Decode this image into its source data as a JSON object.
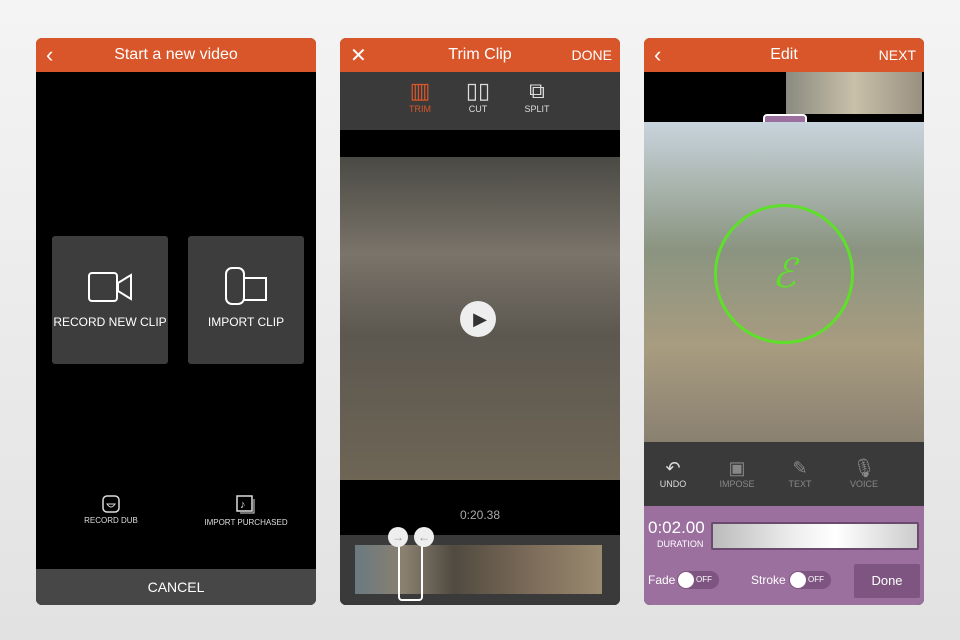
{
  "screen1": {
    "title": "Start a new video",
    "record_new_clip": "RECORD NEW CLIP",
    "import_clip": "IMPORT CLIP",
    "record_dub": "RECORD DUB",
    "import_purchased": "IMPORT PURCHASED",
    "cancel": "CANCEL"
  },
  "screen2": {
    "title": "Trim Clip",
    "done": "DONE",
    "tools": [
      "TRIM",
      "CUT",
      "SPLIT"
    ],
    "active_tool": "TRIM",
    "timestamp": "0:20.38"
  },
  "screen3": {
    "title": "Edit",
    "next": "NEXT",
    "tools": [
      "UNDO",
      "IMPOSE",
      "TEXT",
      "VOICE"
    ],
    "duration_value": "0:02.00",
    "duration_label": "DURATION",
    "fade_label": "Fade",
    "stroke_label": "Stroke",
    "fade_state": "OFF",
    "stroke_state": "OFF",
    "done": "Done"
  },
  "colors": {
    "accent": "#d9552a",
    "panel": "#9b6f9e"
  }
}
